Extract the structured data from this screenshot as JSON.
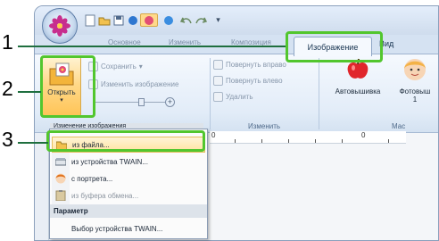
{
  "ribbon": {
    "tabs": {
      "faded1": "Основное",
      "faded2": "Изменить",
      "faded3": "Композиция",
      "image": "Изображение",
      "view": "Вид"
    },
    "open_label": "Открыть",
    "save_label": "Сохранить",
    "edit_image_label": "Изменить изображение",
    "rotate_right_label": "Повернуть вправо",
    "rotate_left_label": "Повернуть влево",
    "delete_label": "Удалить",
    "group_edit_caption": "Изменить",
    "group_image_caption": "Изменение изображения",
    "auto_embroidery_label": "Автовышивка",
    "photo_embroidery_label": "Фотовыш",
    "photo_sub": "1",
    "master_caption": "Мас"
  },
  "menu": {
    "items": [
      {
        "label": "из файла..."
      },
      {
        "label": "из устройства TWAIN..."
      },
      {
        "label": "с портрета..."
      },
      {
        "label": "из буфера обмена..."
      }
    ],
    "section": "Параметр",
    "twain_select": "Выбор устройства TWAIN..."
  },
  "ruler": {
    "tick1": "0",
    "tick2": "0"
  },
  "callouts": [
    "1",
    "2",
    "3"
  ],
  "colors": {
    "highlight": "#52c62e",
    "menu_hover": "#ffe39f",
    "ribbon": "#dfe9f5"
  }
}
